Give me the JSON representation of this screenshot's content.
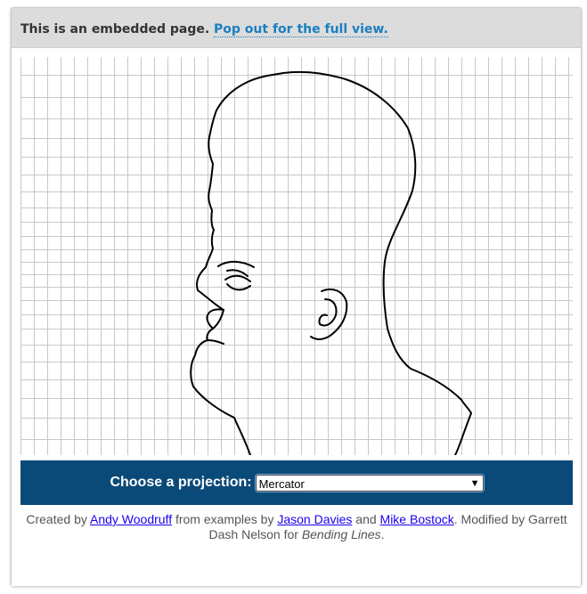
{
  "banner": {
    "text": "This is an embedded page.",
    "link": "Pop out for the full view."
  },
  "controls": {
    "label": "Choose a projection:",
    "selected": "Mercator"
  },
  "credits": {
    "created_by": "Created by",
    "author1": "Andy Woodruff",
    "from_examples": "from examples by",
    "author2": "Jason Davies",
    "and": "and",
    "author3": "Mike Bostock",
    "modified": ". Modified by Garrett Dash Nelson for",
    "publication": "Bending Lines",
    "end": "."
  }
}
